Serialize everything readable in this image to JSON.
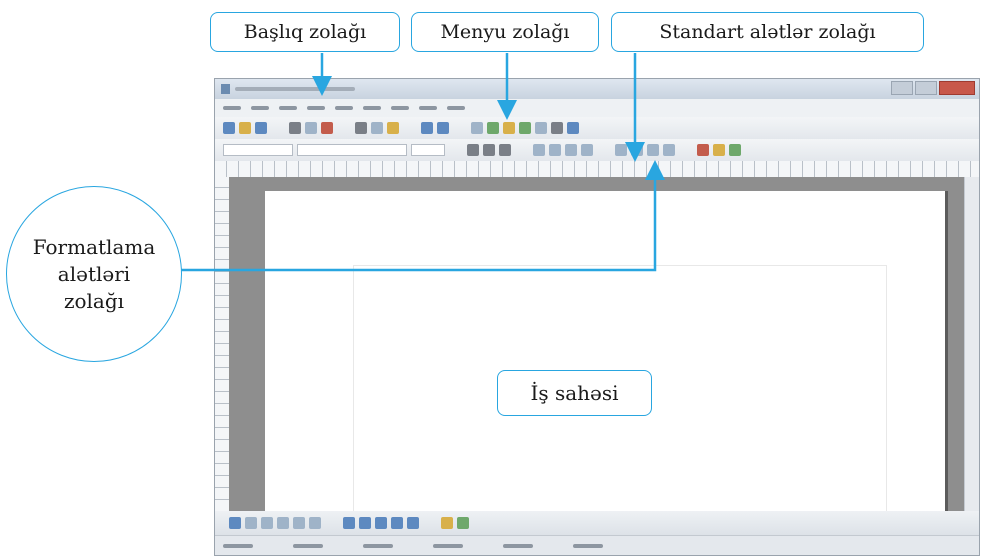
{
  "labels": {
    "title_bar": "Başlıq zolağı",
    "menu_bar": "Menyu zolağı",
    "standard_toolbar": "Standart alətlər zolağı",
    "formatting_toolbar_lines": [
      "Formatlama",
      "alətləri",
      "zolağı"
    ],
    "work_area": "İş sahəsi"
  },
  "colors": {
    "accent": "#29a6e0",
    "label_text": "#1a1a1a"
  }
}
